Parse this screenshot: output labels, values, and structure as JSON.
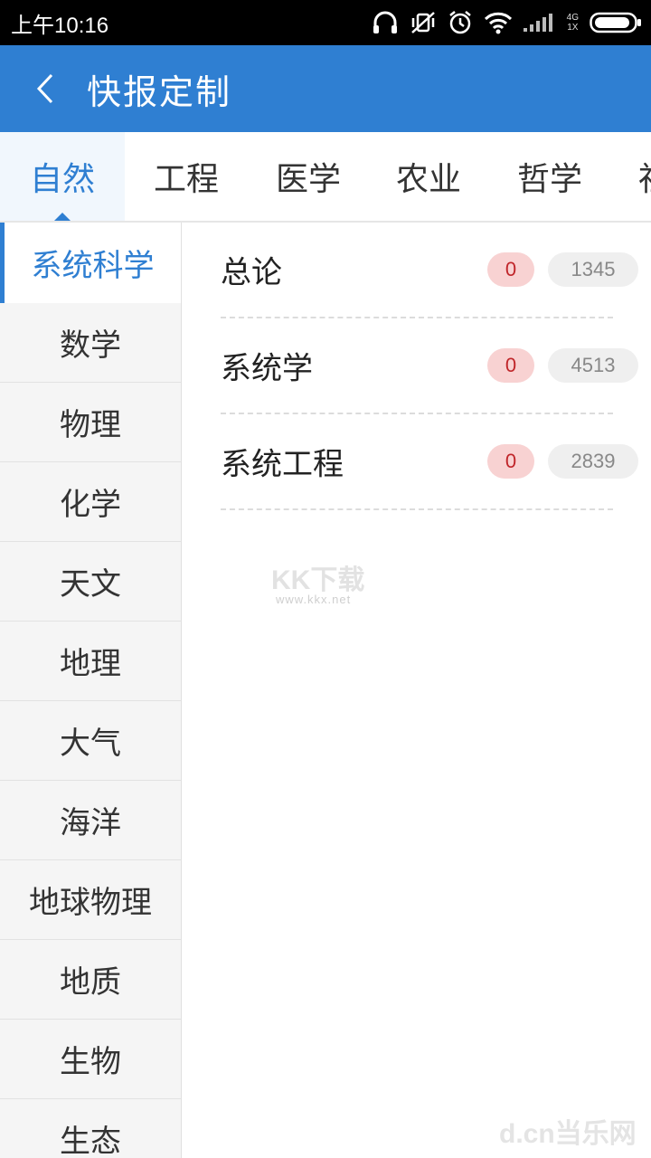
{
  "status_bar": {
    "time": "上午10:16",
    "network_top": "4G",
    "network_bottom": "1X"
  },
  "header": {
    "title": "快报定制",
    "back_icon": "chevron-left-icon"
  },
  "tabs": [
    {
      "label": "自然",
      "active": true
    },
    {
      "label": "工程",
      "active": false
    },
    {
      "label": "医学",
      "active": false
    },
    {
      "label": "农业",
      "active": false
    },
    {
      "label": "哲学",
      "active": false
    },
    {
      "label": "社",
      "active": false
    }
  ],
  "sidebar": {
    "items": [
      {
        "label": "系统科学",
        "active": true
      },
      {
        "label": "数学"
      },
      {
        "label": "物理"
      },
      {
        "label": "化学"
      },
      {
        "label": "天文"
      },
      {
        "label": "地理"
      },
      {
        "label": "大气"
      },
      {
        "label": "海洋"
      },
      {
        "label": "地球物理"
      },
      {
        "label": "地质"
      },
      {
        "label": "生物"
      },
      {
        "label": "生态"
      }
    ]
  },
  "subjects": [
    {
      "name": "总论",
      "unread": "0",
      "total": "1345"
    },
    {
      "name": "系统学",
      "unread": "0",
      "total": "4513"
    },
    {
      "name": "系统工程",
      "unread": "0",
      "total": "2839"
    }
  ],
  "watermark": {
    "main": "KK下载",
    "url": "www.kkx.net",
    "corner": "d.cn当乐网"
  },
  "colors": {
    "brand": "#2f7fd2",
    "unread_bg": "#f8d2d2",
    "unread_text": "#c0262a"
  }
}
